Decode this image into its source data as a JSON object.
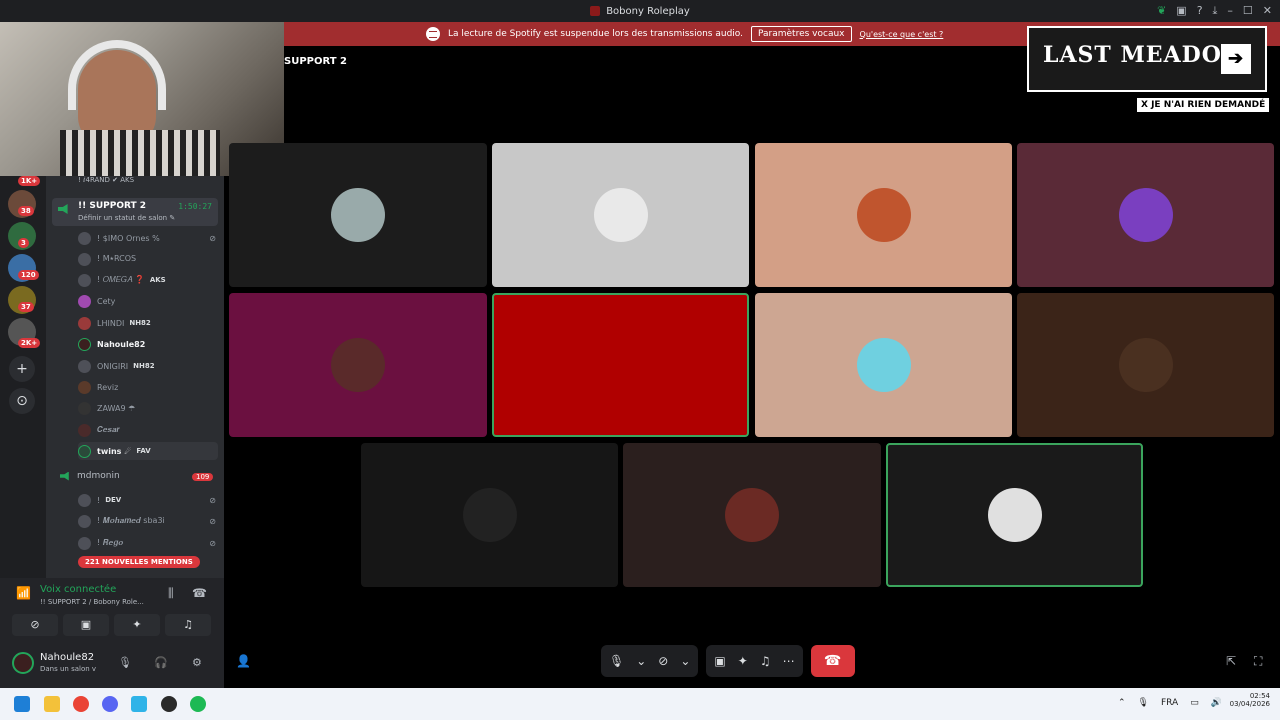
{
  "window": {
    "title": "Bobony Roleplay"
  },
  "banner": {
    "text": "La lecture de Spotify est suspendue lors des transmissions audio.",
    "button": "Paramètres vocaux",
    "link": "Qu'est-ce que c'est ?"
  },
  "servers": {
    "badges": [
      "1K+",
      "38",
      "3",
      "120",
      "37",
      "2K+"
    ],
    "add": "+",
    "explore": "⊙"
  },
  "sidebar": {
    "top_member": "! ⅈ4RAND ✔ AKS",
    "channel": {
      "name": "!! SUPPORT 2",
      "timer": "1:50:27",
      "status": "Définir un statut de salon ✎"
    },
    "members": [
      {
        "name": "! $IMO Ornes %",
        "tag": ""
      },
      {
        "name": "! M⭑RCOS",
        "tag": ""
      },
      {
        "name": "! 𝑂𝑀𝐸𝐺𝐴 ❓",
        "tag": "AKS"
      },
      {
        "name": "Cety",
        "tag": ""
      },
      {
        "name": "LHINDI",
        "tag": "NH82"
      },
      {
        "name": "Nahoule82",
        "tag": ""
      },
      {
        "name": "ONIGIRI",
        "tag": "NH82"
      },
      {
        "name": "Reviz",
        "tag": ""
      },
      {
        "name": "ZAWA9 ☂",
        "tag": ""
      },
      {
        "name": "𝑪𝒆𝒔𝒂𝒓",
        "tag": ""
      },
      {
        "name": "twins ☄",
        "tag": "FAV"
      }
    ],
    "channel2": {
      "name": "mdmonin",
      "badge": "109"
    },
    "members2": [
      {
        "name": "!",
        "tag": "DEV"
      },
      {
        "name": "! 𝑴𝒐𝒉𝒂𝒎𝒆𝒅 sba3i",
        "tag": ""
      },
      {
        "name": "! 𝑹𝒆𝒈𝒐",
        "tag": ""
      }
    ],
    "mentions": "221 NOUVELLES MENTIONS"
  },
  "voice": {
    "title": "Voix connectée",
    "subtitle": "!! SUPPORT 2 / Bobony Role...",
    "user": "Nahoule82",
    "user_status": "Dans un salon v"
  },
  "stage": {
    "title": "SUPPORT 2"
  },
  "overlay": {
    "brand": "LAST MEADOW",
    "arrow": "➔",
    "tag": "X JE N'AI RIEN DEMANDÉ"
  },
  "tiles": [
    {
      "bg": "#1c1c1c",
      "pic": "#9aa"
    },
    {
      "bg": "#c8c8c8",
      "pic": "#e9e9e9"
    },
    {
      "bg": "#d39f86",
      "pic": "#c0552e"
    },
    {
      "bg": "#5a2a37",
      "pic": "#7a3fc0"
    },
    {
      "bg": "#6b1040",
      "pic": "#5a2a2a"
    },
    {
      "bg": "#b00000",
      "pic": "#b00000"
    },
    {
      "bg": "#cda692",
      "pic": "#6fd0e0"
    },
    {
      "bg": "#3b2418",
      "pic": "#4a3020"
    },
    {
      "bg": "#161616",
      "pic": "#222"
    },
    {
      "bg": "#2b1f1e",
      "pic": "#6b2a24"
    },
    {
      "bg": "#1a1a1a",
      "pic": "#e0e0e0"
    }
  ],
  "taskbar": {
    "lang": "FRA",
    "time": "02:54",
    "date": "03/04/2026"
  }
}
